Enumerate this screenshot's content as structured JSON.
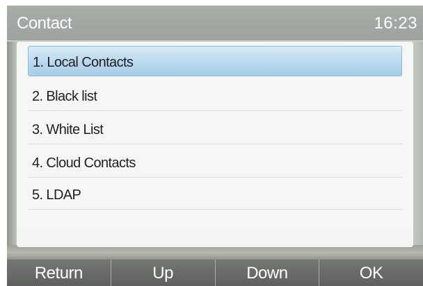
{
  "header": {
    "title": "Contact",
    "time": "16:23"
  },
  "menu": {
    "selected_index": 0,
    "items": [
      {
        "label": "1. Local Contacts"
      },
      {
        "label": "2. Black list"
      },
      {
        "label": "3. White List"
      },
      {
        "label": "4. Cloud Contacts"
      },
      {
        "label": "5. LDAP"
      }
    ]
  },
  "softkeys": [
    "Return",
    "Up",
    "Down",
    "OK"
  ],
  "colors": {
    "selection": "#b9d8ee",
    "title_text": "#ffffff"
  }
}
